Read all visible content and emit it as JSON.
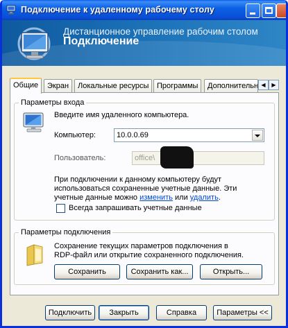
{
  "window": {
    "title": "Подключение к удаленному рабочему столу"
  },
  "banner": {
    "line1": "Дистанционное управление рабочим столом",
    "line2": "Подключение"
  },
  "tabs": [
    {
      "label": "Общие",
      "active": true
    },
    {
      "label": "Экран",
      "active": false
    },
    {
      "label": "Локальные ресурсы",
      "active": false
    },
    {
      "label": "Программы",
      "active": false
    },
    {
      "label": "Дополнительн",
      "active": false
    }
  ],
  "login": {
    "group_title": "Параметры входа",
    "prompt": "Введите имя удаленного компьютера.",
    "computer_label": "Компьютер:",
    "computer_value": "10.0.0.69",
    "user_label": "Пользователь:",
    "user_value": "office\\",
    "info_line1": "При подключении к данному компьютеру будут",
    "info_line2": "использоваться сохраненные учетные данные.  Эти",
    "info_line3_prefix": "учетные данные можно ",
    "link_change": "изменить",
    "info_or": " или ",
    "link_delete": "удалить",
    "info_end": ".",
    "always_ask_label": "Всегда запрашивать учетные данные",
    "always_ask_checked": false
  },
  "connection": {
    "group_title": "Параметры подключения",
    "desc_line1": "Сохранение текущих параметров подключения в",
    "desc_line2": "RDP-файл или открытие сохраненного подключения.",
    "save_label": "Сохранить",
    "save_as_label": "Сохранить как...",
    "open_label": "Открыть..."
  },
  "footer": {
    "connect_label": "Подключить",
    "close_label": "Закрыть",
    "help_label": "Справка",
    "options_label": "Параметры <<"
  },
  "colors": {
    "titlebar": "#0a4fd6",
    "banner": "#1a6fb5",
    "accent_stripe": "#f5a040",
    "link": "#0046d5"
  }
}
